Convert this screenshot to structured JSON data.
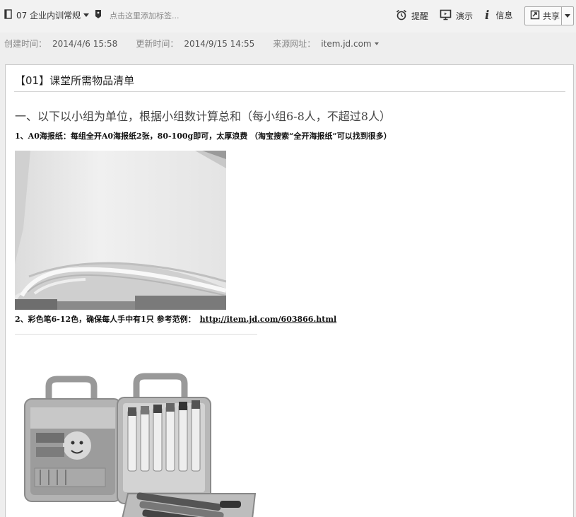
{
  "toolbar": {
    "notebook": "07 企业内训常规",
    "tag_placeholder": "点击这里添加标签...",
    "remind": "提醒",
    "present": "演示",
    "info": "信息",
    "share": "共享"
  },
  "meta": {
    "created_label": "创建时间：",
    "created_value": "2014/4/6 15:58",
    "updated_label": "更新时间：",
    "updated_value": "2014/9/15 14:55",
    "source_label": "来源网址：",
    "source_value": "item.jd.com"
  },
  "note": {
    "title": "【01】课堂所需物品清单",
    "heading": "一、以下以小组为单位，根据小组数计算总和（每小组6-8人，不超过8人）",
    "item1": "1、A0海报纸：每组全开A0海报纸2张，80-100g即可，太厚浪费 （淘宝搜索“全开海报纸”可以找到很多）",
    "item2_text": "2、彩色笔6-12色，确保每人手中有1只   参考范例：",
    "item2_link": "http://item.jd.com/603866.html"
  },
  "icons": {
    "notebook": "notebook-icon",
    "tag": "tag-icon",
    "remind": "alarm-clock-icon",
    "present": "presentation-icon",
    "info": "info-icon",
    "share": "share-icon"
  }
}
